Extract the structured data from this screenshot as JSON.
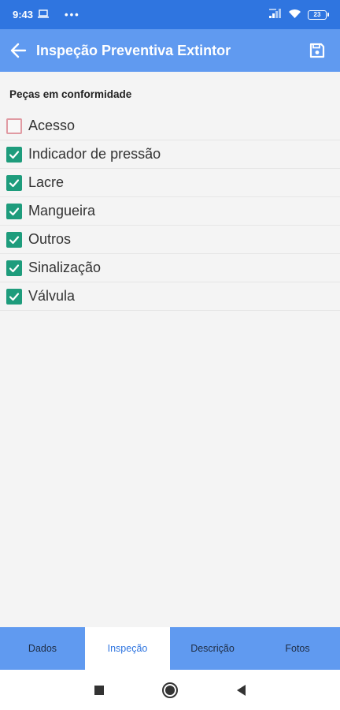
{
  "status_bar": {
    "time": "9:43",
    "dots": "•••",
    "battery": "23"
  },
  "app_bar": {
    "title": "Inspeção Preventiva Extintor"
  },
  "section": {
    "title": "Peças em conformidade"
  },
  "items": [
    {
      "label": "Acesso",
      "checked": false
    },
    {
      "label": "Indicador de pressão",
      "checked": true
    },
    {
      "label": "Lacre",
      "checked": true
    },
    {
      "label": "Mangueira",
      "checked": true
    },
    {
      "label": "Outros",
      "checked": true
    },
    {
      "label": "Sinalização",
      "checked": true
    },
    {
      "label": "Válvula",
      "checked": true
    }
  ],
  "tabs": [
    {
      "label": "Dados",
      "active": false
    },
    {
      "label": "Inspeção",
      "active": true
    },
    {
      "label": "Descrição",
      "active": false
    },
    {
      "label": "Fotos",
      "active": false
    }
  ],
  "colors": {
    "status_bar": "#2f75e0",
    "app_bar": "#609af0",
    "checkbox_checked": "#1e9c7c",
    "checkbox_unchecked_border": "#e09aa2",
    "active_tab_text": "#2f75e0"
  }
}
